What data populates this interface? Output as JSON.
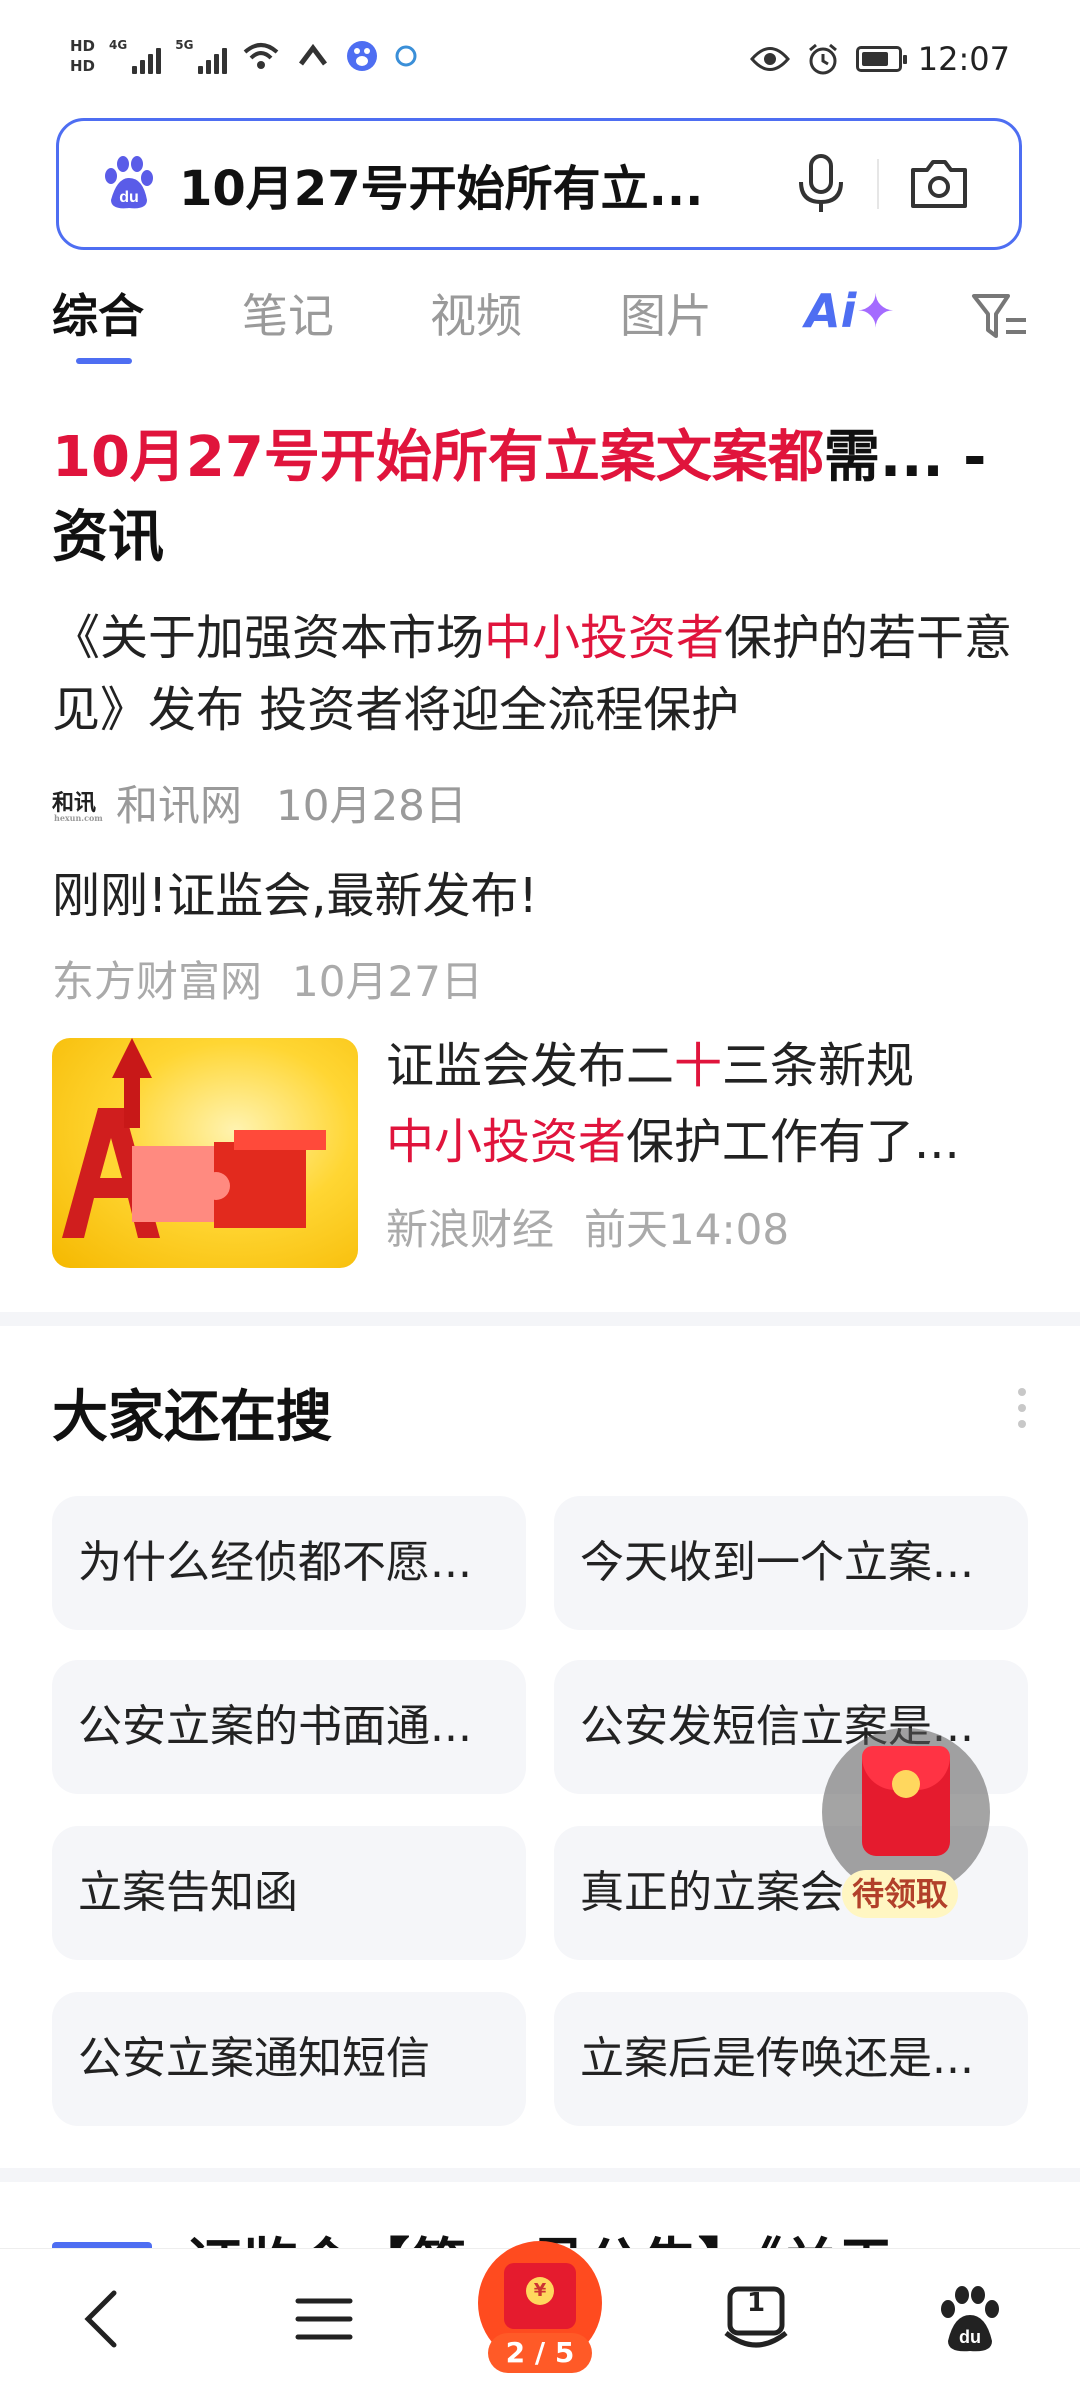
{
  "status_bar": {
    "hd1": "HD",
    "hd2": "HD",
    "net1": "4G",
    "net2": "5G",
    "time": "12:07",
    "battery_level": 0.75,
    "icons": [
      "signal-icon",
      "wifi-icon",
      "nfc-icon",
      "baidu-notify-icon",
      "chat-notify-icon",
      "eye-icon",
      "alarm-icon",
      "battery-icon"
    ]
  },
  "search": {
    "query": "10月27号开始所有立...",
    "logo": "baidu-paw-icon"
  },
  "tabs": [
    {
      "label": "综合",
      "active": true
    },
    {
      "label": "笔记",
      "active": false
    },
    {
      "label": "视频",
      "active": false
    },
    {
      "label": "图片",
      "active": false
    },
    {
      "label": "Ai",
      "active": false
    }
  ],
  "result": {
    "title_highlight": "10月27号开始所有立案文案都",
    "title_rest": "需... -",
    "title_line2": "资讯",
    "summary_pre": "《关于加强资本市场",
    "summary_hl": "中小投资者",
    "summary_post": "保护的若干意见》发布 投资者将迎全流程保护",
    "source_logo": "和讯",
    "source_logo_sub": "hexun.com",
    "source": "和讯网",
    "date": "10月28日",
    "news2_title": "刚刚!证监会,最新发布!",
    "news2_source": "东方财富网",
    "news2_date": "10月27日",
    "news3_pre": "证监会发布二",
    "news3_hl1": "十",
    "news3_mid": "三条新规",
    "news3_hl2": "中小投资者",
    "news3_post": "保护工作有了...",
    "news3_source": "新浪财经",
    "news3_date": "前天14:08"
  },
  "also_searched": {
    "title": "大家还在搜",
    "items": [
      "为什么经侦都不愿...",
      "今天收到一个立案...",
      "公安立案的书面通...",
      "公安发短信立案是...",
      "立案告知函",
      "真正的立案会...",
      "公安立案通知短信",
      "立案后是传唤还是..."
    ]
  },
  "float_packet": {
    "label": "待领取"
  },
  "peek": {
    "text": "证监会【第...号公告】《关于..."
  },
  "bottom_nav": {
    "center_badge": "2 / 5",
    "tab_count": "1",
    "center_coin": "¥"
  },
  "colors": {
    "accent": "#4e6ef2",
    "highlight_red": "#e0143c",
    "chip_bg": "#f5f6f9",
    "ai_purple": "#a46bff"
  }
}
